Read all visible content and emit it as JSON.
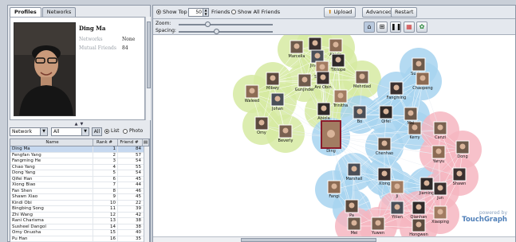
{
  "tabs": [
    {
      "label": "Profiles",
      "active": true
    },
    {
      "label": "Networks",
      "active": false
    }
  ],
  "profile": {
    "name": "Ding Ma",
    "fields": [
      {
        "label": "Networks",
        "value": "None"
      },
      {
        "label": "Mutual Friends",
        "value": "84"
      }
    ]
  },
  "filters": {
    "network_select": "Network",
    "scope_select": "All",
    "all_button": "All",
    "view_options": [
      {
        "label": "List",
        "selected": true
      },
      {
        "label": "Photo",
        "selected": false
      }
    ]
  },
  "table": {
    "columns": [
      "Name",
      "Rank #",
      "Friend #"
    ],
    "rows": [
      {
        "name": "Ding Ma",
        "rank": "1",
        "friends": "84",
        "selected": true
      },
      {
        "name": "Fengfan Yang",
        "rank": "2",
        "friends": "57"
      },
      {
        "name": "Fangming He",
        "rank": "3",
        "friends": "54"
      },
      {
        "name": "Chao Yang",
        "rank": "4",
        "friends": "55"
      },
      {
        "name": "Dong Yang",
        "rank": "5",
        "friends": "54"
      },
      {
        "name": "Qifei Han",
        "rank": "6",
        "friends": "45"
      },
      {
        "name": "Xiong Biao",
        "rank": "7",
        "friends": "44"
      },
      {
        "name": "Fan Shen",
        "rank": "8",
        "friends": "46"
      },
      {
        "name": "Shawn Xiao",
        "rank": "9",
        "friends": "45"
      },
      {
        "name": "Kindi Obi",
        "rank": "10",
        "friends": "22"
      },
      {
        "name": "Bingbing Song",
        "rank": "11",
        "friends": "39"
      },
      {
        "name": "Zhi Wang",
        "rank": "12",
        "friends": "42"
      },
      {
        "name": "Rani Charisma",
        "rank": "13",
        "friends": "38"
      },
      {
        "name": "Susheel Dangol",
        "rank": "14",
        "friends": "38"
      },
      {
        "name": "Omy Onuoha",
        "rank": "15",
        "friends": "40"
      },
      {
        "name": "Pu Han",
        "rank": "16",
        "friends": "35"
      }
    ]
  },
  "toolbar": {
    "show_top_label": "Show Top",
    "show_top_value": "50",
    "friends_label": "Friends",
    "show_all_label": "Show All Friends",
    "show_top_selected": true,
    "upload_label": "Upload",
    "advanced_label": "Advanced",
    "restart_label": "Restart"
  },
  "sliders": {
    "zoom_label": "Zoom:",
    "zoom_level": 0.3,
    "spacing_label": "Spacing:",
    "spacing_level": 0.4
  },
  "graph": {
    "cluster_colors": {
      "green": "#d6eaa2",
      "blue": "#a7d4f0",
      "pink": "#f6b6c1"
    },
    "nodes": [
      {
        "label": "Marcella",
        "cluster": "green"
      },
      {
        "label": "Tiwa",
        "cluster": "green"
      },
      {
        "label": "Abiola",
        "cluster": "green"
      },
      {
        "label": "Jingjing",
        "cluster": "green"
      },
      {
        "label": "Titilope",
        "cluster": "green"
      },
      {
        "label": "Sharath",
        "cluster": "green"
      },
      {
        "label": "Mibwy",
        "cluster": "green"
      },
      {
        "label": "Mehrdad",
        "cluster": "green"
      },
      {
        "label": "Gunjinder",
        "cluster": "green"
      },
      {
        "label": "Ani Obin",
        "cluster": "green"
      },
      {
        "label": "Waleed",
        "cluster": "green"
      },
      {
        "label": "Johan",
        "cluster": "green"
      },
      {
        "label": "Abiola",
        "cluster": "green"
      },
      {
        "label": "Trinitha",
        "cluster": "green"
      },
      {
        "label": "Omy",
        "cluster": "green"
      },
      {
        "label": "Beverly",
        "cluster": "green"
      },
      {
        "label": "Susheel",
        "cluster": "blue"
      },
      {
        "label": "Fangming",
        "cluster": "blue"
      },
      {
        "label": "Chaopeng",
        "cluster": "blue"
      },
      {
        "label": "Bo",
        "cluster": "blue"
      },
      {
        "label": "Qifei",
        "cluster": "blue"
      },
      {
        "label": "Ding",
        "cluster": "blue"
      },
      {
        "label": "Chenhao",
        "cluster": "blue"
      },
      {
        "label": "Kerry",
        "cluster": "blue"
      },
      {
        "label": "Mai",
        "cluster": "blue"
      },
      {
        "label": "Xiong",
        "cluster": "blue"
      },
      {
        "label": "Fangi",
        "cluster": "blue"
      },
      {
        "label": "Marshall",
        "cluster": "blue"
      },
      {
        "label": "Jiaming",
        "cluster": "blue"
      },
      {
        "label": "Ji",
        "cluster": "blue"
      },
      {
        "label": "Pa",
        "cluster": "blue"
      },
      {
        "label": "Canzi",
        "cluster": "pink"
      },
      {
        "label": "Dong",
        "cluster": "pink"
      },
      {
        "label": "Shawn",
        "cluster": "pink"
      },
      {
        "label": "Yanyu",
        "cluster": "pink"
      },
      {
        "label": "Yitian",
        "cluster": "pink"
      },
      {
        "label": "Qianhan",
        "cluster": "pink"
      },
      {
        "label": "Xiaoping",
        "cluster": "pink"
      },
      {
        "label": "Hongwen",
        "cluster": "pink"
      },
      {
        "label": "Yuwen",
        "cluster": "pink"
      },
      {
        "label": "Mei",
        "cluster": "pink"
      },
      {
        "label": "Jun",
        "cluster": "pink"
      }
    ]
  },
  "branding": {
    "powered_by": "powered by",
    "brand": "TouchGraph"
  },
  "colors": {
    "panel_bg": "#e6e9ee",
    "selection": "#c6d8ef",
    "focus_border": "#8b1a2a",
    "brand": "#4f7fb8"
  }
}
